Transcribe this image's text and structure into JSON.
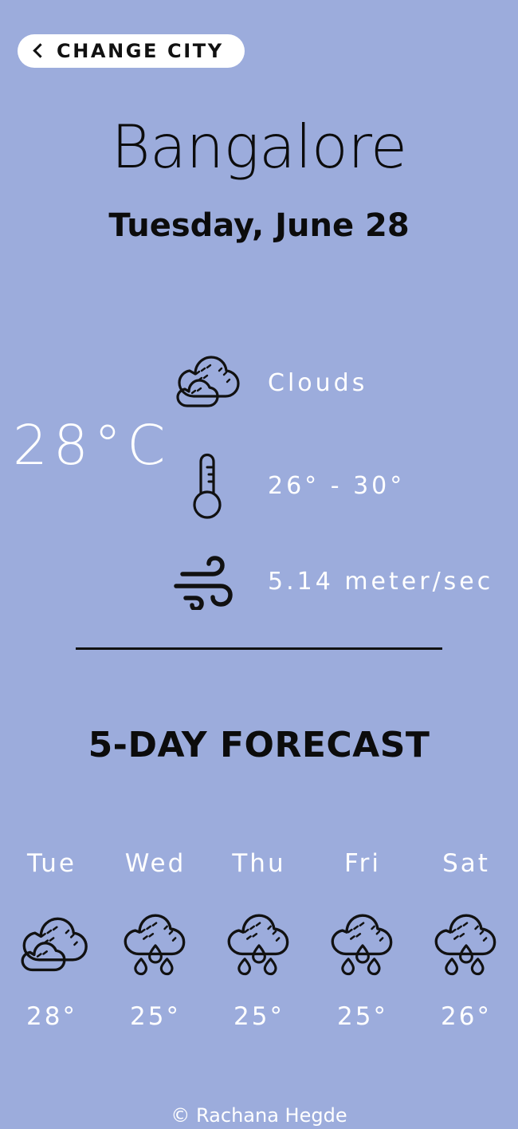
{
  "app": {
    "background_color": "#9cacdc",
    "text_white": "#ffffff",
    "text_dark": "#0c0c0c"
  },
  "header": {
    "change_city_label": "CHANGE CITY",
    "back_icon": "chevron-left-icon",
    "city": "Bangalore",
    "date": "Tuesday, June 28"
  },
  "current": {
    "temperature": "28°C",
    "condition_icon": "clouds-icon",
    "condition": "Clouds",
    "range_icon": "thermometer-icon",
    "range": "26° - 30°",
    "wind_icon": "wind-icon",
    "wind": "5.14 meter/sec"
  },
  "forecast": {
    "title": "5-DAY FORECAST",
    "days": [
      {
        "day": "Tue",
        "icon": "clouds-icon",
        "temp": "28°"
      },
      {
        "day": "Wed",
        "icon": "rain-cloud-icon",
        "temp": "25°"
      },
      {
        "day": "Thu",
        "icon": "rain-cloud-icon",
        "temp": "25°"
      },
      {
        "day": "Fri",
        "icon": "rain-cloud-icon",
        "temp": "25°"
      },
      {
        "day": "Sat",
        "icon": "rain-cloud-icon",
        "temp": "26°"
      }
    ]
  },
  "footer": {
    "credit": "© Rachana Hegde"
  }
}
